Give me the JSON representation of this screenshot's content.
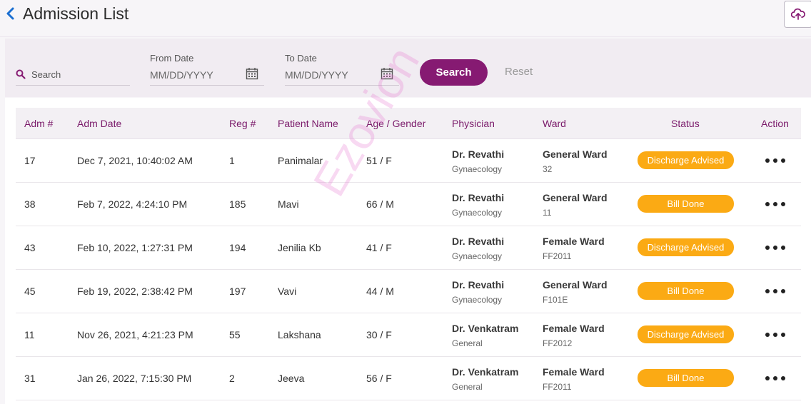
{
  "header": {
    "title": "Admission List"
  },
  "filters": {
    "search_placeholder": "Search",
    "from_date_label": "From Date",
    "from_date_placeholder": "MM/DD/YYYY",
    "to_date_label": "To Date",
    "to_date_placeholder": "MM/DD/YYYY",
    "search_button": "Search",
    "reset_button": "Reset"
  },
  "table": {
    "columns": [
      "Adm #",
      "Adm Date",
      "Reg #",
      "Patient Name",
      "Age / Gender",
      "Physician",
      "Ward",
      "Status",
      "Action"
    ],
    "rows": [
      {
        "adm": "17",
        "date": "Dec 7, 2021, 10:40:02 AM",
        "reg": "1",
        "name": "Panimalar",
        "age": "51 / F",
        "physician": "Dr. Revathi",
        "dept": "Gynaecology",
        "ward": "General Ward",
        "bed": "32",
        "status": "Discharge Advised"
      },
      {
        "adm": "38",
        "date": "Feb 7, 2022, 4:24:10 PM",
        "reg": "185",
        "name": "Mavi",
        "age": "66 / M",
        "physician": "Dr. Revathi",
        "dept": "Gynaecology",
        "ward": "General Ward",
        "bed": "11",
        "status": "Bill Done"
      },
      {
        "adm": "43",
        "date": "Feb 10, 2022, 1:27:31 PM",
        "reg": "194",
        "name": "Jenilia Kb",
        "age": "41 / F",
        "physician": "Dr. Revathi",
        "dept": "Gynaecology",
        "ward": "Female Ward",
        "bed": "FF2011",
        "status": "Discharge Advised"
      },
      {
        "adm": "45",
        "date": "Feb 19, 2022, 2:38:42 PM",
        "reg": "197",
        "name": "Vavi",
        "age": "44 / M",
        "physician": "Dr. Revathi",
        "dept": "Gynaecology",
        "ward": "General Ward",
        "bed": "F101E",
        "status": "Bill Done"
      },
      {
        "adm": "11",
        "date": "Nov 26, 2021, 4:21:23 PM",
        "reg": "55",
        "name": "Lakshana",
        "age": "30 / F",
        "physician": "Dr. Venkatram",
        "dept": "General",
        "ward": "Female Ward",
        "bed": "FF2012",
        "status": "Discharge Advised"
      },
      {
        "adm": "31",
        "date": "Jan 26, 2022, 7:15:30 PM",
        "reg": "2",
        "name": "Jeeva",
        "age": "56 / F",
        "physician": "Dr. Venkatram",
        "dept": "General",
        "ward": "Female Ward",
        "bed": "FF2011",
        "status": "Bill Done"
      }
    ]
  },
  "watermark": "Ezovion",
  "colors": {
    "accent": "#861a72",
    "badge": "#fbaa14",
    "back_arrow": "#1c6fd1"
  },
  "icons": {
    "back": "chevron-left-icon",
    "cloud": "cloud-upload-icon",
    "search": "search-icon",
    "calendar": "calendar-icon",
    "action": "more-horizontal-icon"
  }
}
